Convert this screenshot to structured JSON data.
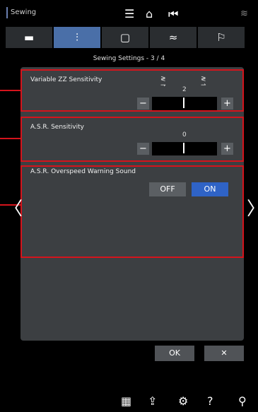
{
  "app": {
    "label": "Sewing"
  },
  "top_icons": [
    "menu-icon",
    "home-icon",
    "back-stop-icon",
    "wifi-icon"
  ],
  "tabs": [
    {
      "name": "machine-icon",
      "glyph": "▬"
    },
    {
      "name": "stitch-icon",
      "glyph": "⫶"
    },
    {
      "name": "square-icon",
      "glyph": "▢"
    },
    {
      "name": "wifi-icon",
      "glyph": "≈"
    },
    {
      "name": "flag-icon",
      "glyph": "⚐"
    }
  ],
  "page": {
    "subtitle": "Sewing Settings - 3 / 4"
  },
  "settings": {
    "zz": {
      "title": "Variable ZZ Sensitivity",
      "value": "2",
      "minus": "−",
      "plus": "+"
    },
    "asr": {
      "title": "A.S.R. Sensitivity",
      "value": "0",
      "minus": "−",
      "plus": "+"
    },
    "warning": {
      "title": "A.S.R. Overspeed Warning Sound",
      "off_label": "OFF",
      "on_label": "ON",
      "selected": "ON"
    }
  },
  "nav": {
    "prev": "〈",
    "next": "〉"
  },
  "dialog": {
    "ok_label": "OK",
    "cancel_label": "✕"
  },
  "bottom_icons": [
    "pattern-icon",
    "upload-icon",
    "gear-icon",
    "help-icon",
    "wrench-icon"
  ],
  "colors": {
    "accent": "#2f63c6",
    "highlight": "#d4141c",
    "tab_active": "#4a6fa8"
  }
}
